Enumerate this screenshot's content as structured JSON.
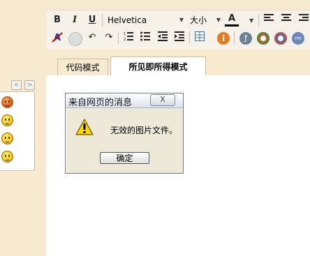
{
  "toolbar": {
    "bold": "B",
    "italic": "I",
    "underline": "U",
    "font_family": "Helvetica",
    "font_size": "大小",
    "font_color": "A",
    "accent": "#2a5bd7"
  },
  "tabs": [
    {
      "label": "代码模式",
      "active": false
    },
    {
      "label": "所见即所得模式",
      "active": true
    }
  ],
  "emoticon_nav": {
    "prev": "<",
    "next": ">"
  },
  "dialog": {
    "title": "来自网页的消息",
    "message": "无效的图片文件。",
    "ok_label": "确定",
    "close_label": "X"
  }
}
